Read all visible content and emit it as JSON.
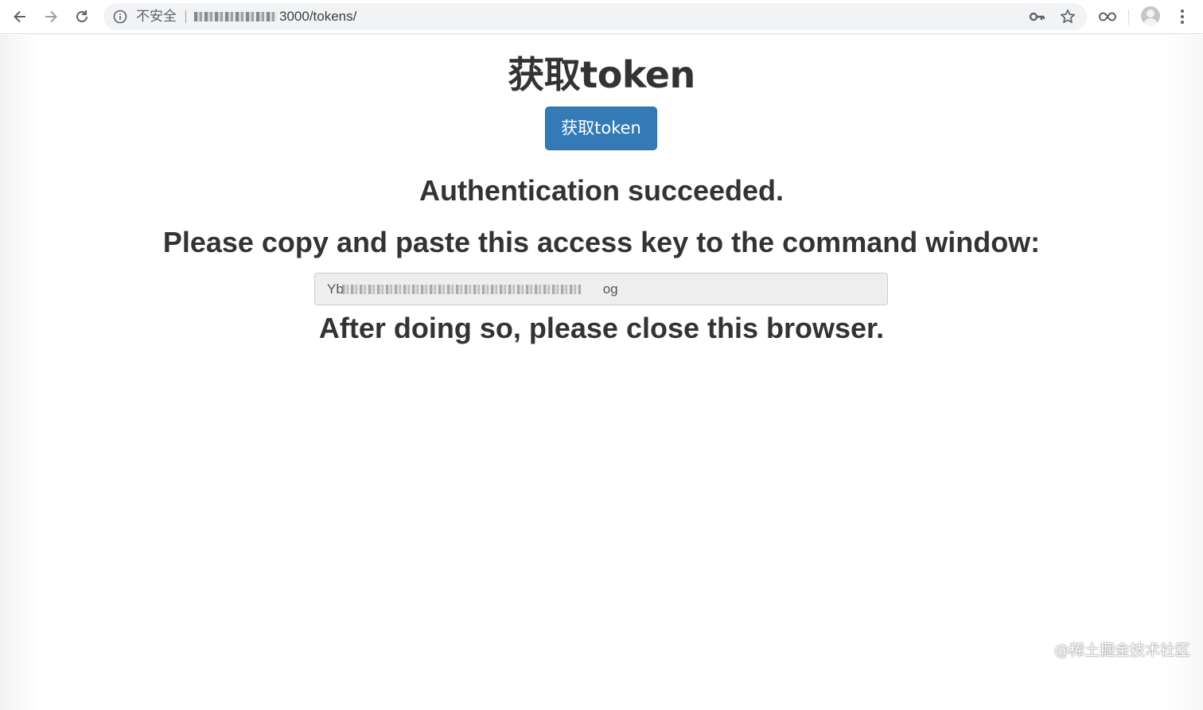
{
  "browser": {
    "nav": {
      "back_icon": "arrow-left-icon",
      "forward_icon": "arrow-right-icon",
      "reload_icon": "reload-icon"
    },
    "omnibox": {
      "security_label": "不安全",
      "url_path": "3000/tokens/"
    },
    "icons": [
      "info-icon",
      "key-icon",
      "star-icon",
      "extension-icon",
      "avatar-icon",
      "more-vert-icon"
    ]
  },
  "page": {
    "title": "获取token",
    "button_label": "获取token",
    "success_message": "Authentication succeeded.",
    "instruction": "Please copy and paste this access key to the command window:",
    "access_key_value": "Yb                                                                     og",
    "close_message": "After doing so, please close this browser."
  },
  "watermark": {
    "text": "@稀土掘金技术社区"
  },
  "colors": {
    "primary_button": "#337ab7",
    "text": "#333333",
    "input_bg": "#eeeeee"
  }
}
